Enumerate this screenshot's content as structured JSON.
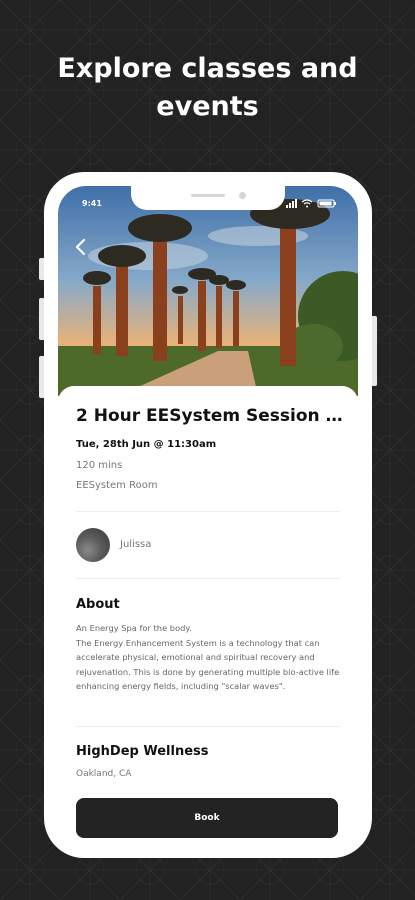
{
  "headline": {
    "line1": "Explore classes and",
    "line2": "events"
  },
  "status_bar": {
    "time": "9:41"
  },
  "icons": {
    "back": "chevron-left-icon",
    "signal": "signal-icon",
    "wifi": "wifi-icon",
    "battery": "battery-icon"
  },
  "event": {
    "title": "2 Hour EESystem Session f....",
    "date": "Tue, 28th Jun @ 11:30am",
    "duration": "120 mins",
    "room": "EESystem Room"
  },
  "host": {
    "name": "Julissa"
  },
  "about": {
    "heading": "About",
    "text": "An Energy Spa for the body.\nThe Energy Enhancement System is a technology that can accelerate physical, emotional and spiritual recovery and rejuvenation. This is done by generating multiple bio-active life enhancing energy fields, including \"scalar waves\"."
  },
  "venue": {
    "name": "HighDep Wellness",
    "location": "Oakland, CA"
  },
  "actions": {
    "book_label": "Book"
  },
  "colors": {
    "background": "#222222",
    "button": "#232323",
    "text_primary": "#111111",
    "text_secondary": "#777777"
  }
}
